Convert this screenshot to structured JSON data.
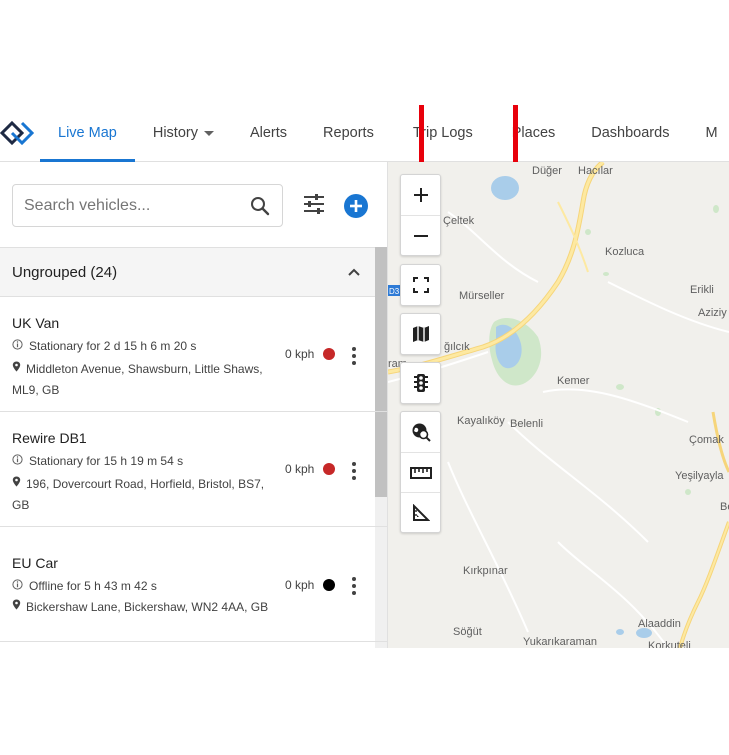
{
  "nav": {
    "logo_icon": "app-logo-icon",
    "items": [
      {
        "label": "Live Map"
      },
      {
        "label": "History"
      },
      {
        "label": "Alerts"
      },
      {
        "label": "Reports"
      },
      {
        "label": "Trip Logs"
      },
      {
        "label": "Places"
      },
      {
        "label": "Dashboards"
      },
      {
        "label": "M"
      }
    ],
    "active_item": "Live Map",
    "highlighted_item": "Trip Logs",
    "accent_color": "#1976d2",
    "highlight_color": "#e8000b"
  },
  "sidebar": {
    "search_placeholder": "Search vehicles...",
    "group": {
      "title": "Ungrouped (24)"
    },
    "vehicles": [
      {
        "name": "UK Van",
        "status": "Stationary for 2 d 15 h 6 m 20 s",
        "address": "Middleton Avenue, Shawsburn, Little Shaws, ML9, GB",
        "speed": "0 kph",
        "status_color": "#c62828"
      },
      {
        "name": "Rewire DB1",
        "status": "Stationary for 15 h 19 m 54 s",
        "address": "196, Dovercourt Road, Horfield, Bristol, BS7, GB",
        "speed": "0 kph",
        "status_color": "#c62828"
      },
      {
        "name": "EU Car",
        "status": "Offline for 5 h 43 m 42 s",
        "address": "Bickershaw Lane, Bickershaw, WN2 4AA, GB",
        "speed": "0 kph",
        "status_color": "#000000"
      }
    ]
  },
  "map": {
    "places": [
      "Düğer",
      "Hacılar",
      "Çeltek",
      "Kozluca",
      "Erikli",
      "Aziziy",
      "Mürseller",
      "ğılcık",
      "ram",
      "Kemer",
      "Kayalıköy",
      "Belenli",
      "Çomak",
      "Yeşilyayla",
      "Be",
      "Kırkpınar",
      "Söğüt",
      "Yukarıkaraman",
      "Alaaddin",
      "Korkuteli"
    ],
    "road_badge": "D3"
  }
}
